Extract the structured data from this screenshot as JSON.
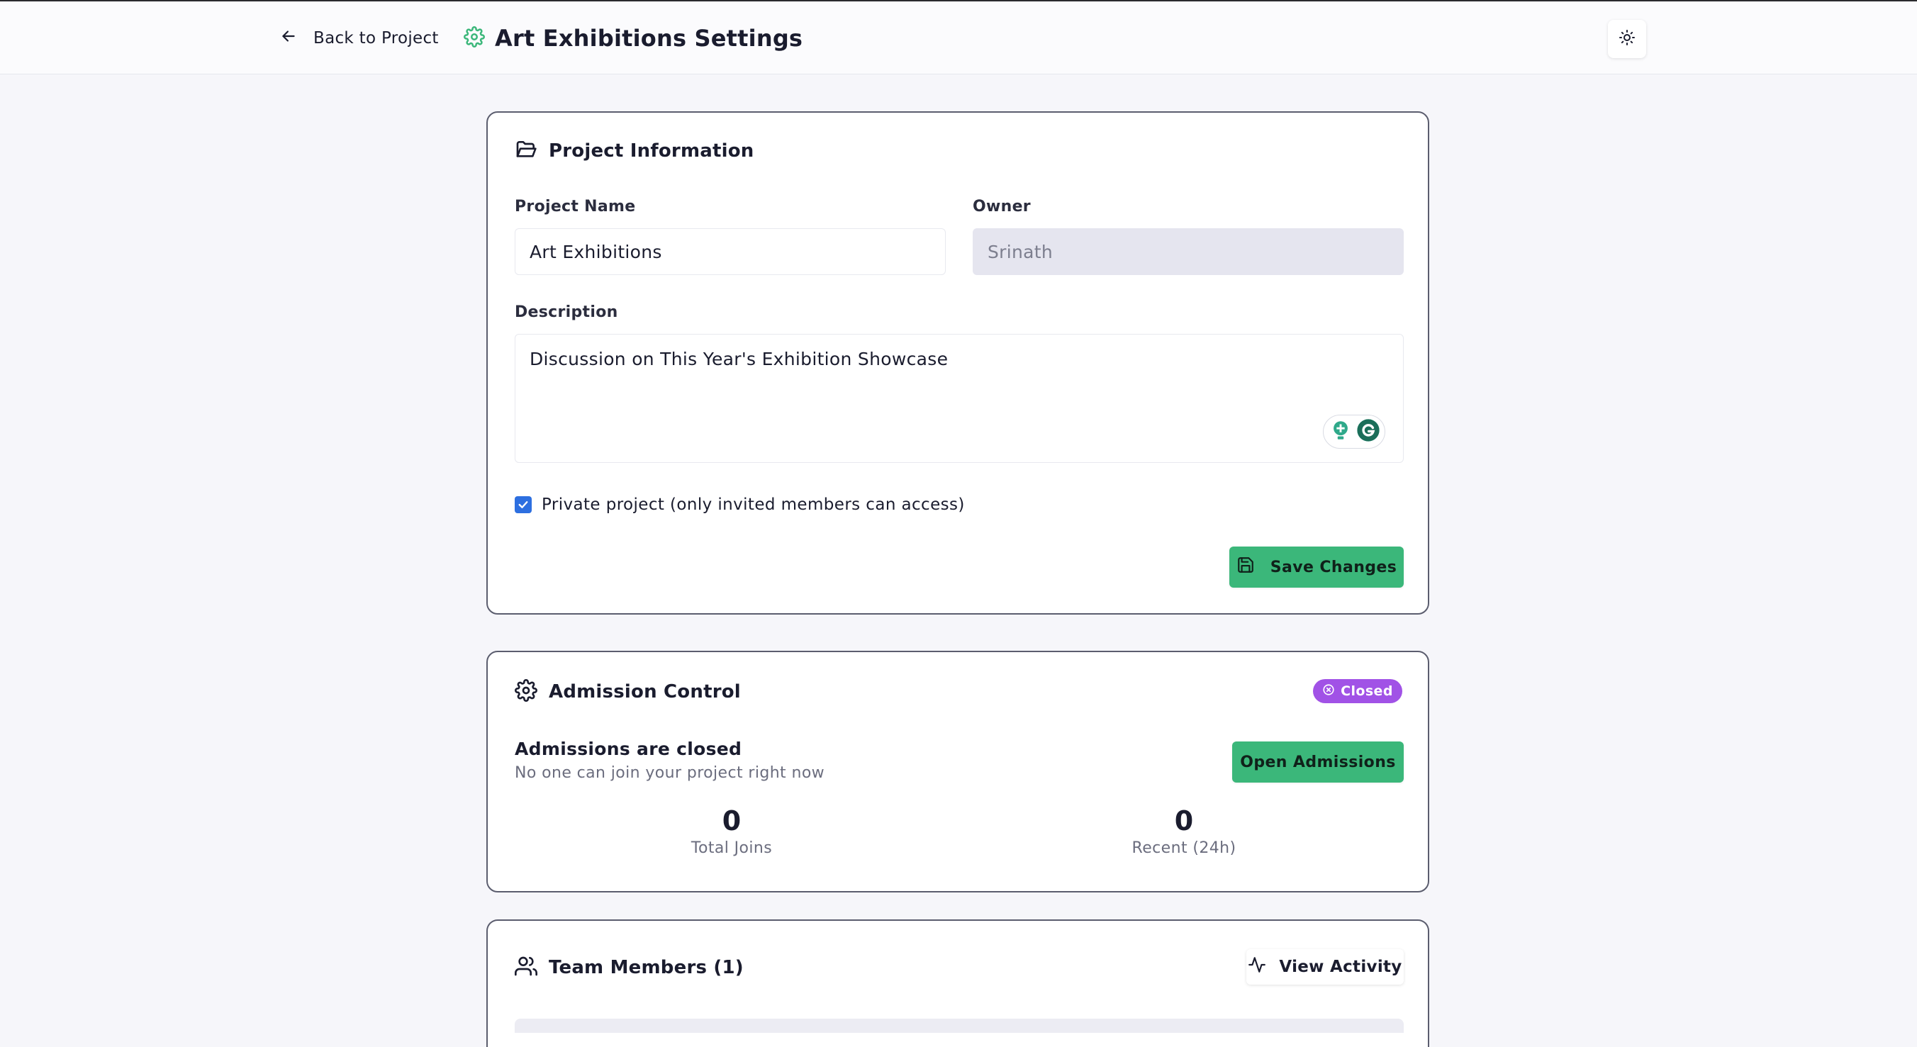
{
  "header": {
    "back_label": "Back to Project",
    "page_title": "Art Exhibitions Settings",
    "icons": {
      "back": "arrow-left-icon",
      "title": "gear-icon",
      "theme": "sun-icon"
    }
  },
  "project_info": {
    "title": "Project Information",
    "icon": "folder-open-icon",
    "name_label": "Project Name",
    "name_value": "Art Exhibitions",
    "owner_label": "Owner",
    "owner_value": "Srinath",
    "description_label": "Description",
    "description_value": "Discussion on This Year's Exhibition Showcase",
    "private_checked": true,
    "private_label": "Private project (only invited members can access)",
    "save_label": "Save Changes"
  },
  "admission": {
    "title": "Admission Control",
    "icon": "gear-icon",
    "badge": "Closed",
    "status_title": "Admissions are closed",
    "status_sub": "No one can join your project right now",
    "open_button": "Open Admissions",
    "stats": [
      {
        "value": "0",
        "label": "Total Joins"
      },
      {
        "value": "0",
        "label": "Recent (24h)"
      }
    ]
  },
  "team": {
    "title": "Team Members (1)",
    "icon": "users-icon",
    "activity_button": "View Activity"
  },
  "colors": {
    "accent_green": "#3bb77a",
    "badge_purple": "#a152e6",
    "checkbox_blue": "#2d6fe0",
    "background": "#f6f6fa"
  }
}
